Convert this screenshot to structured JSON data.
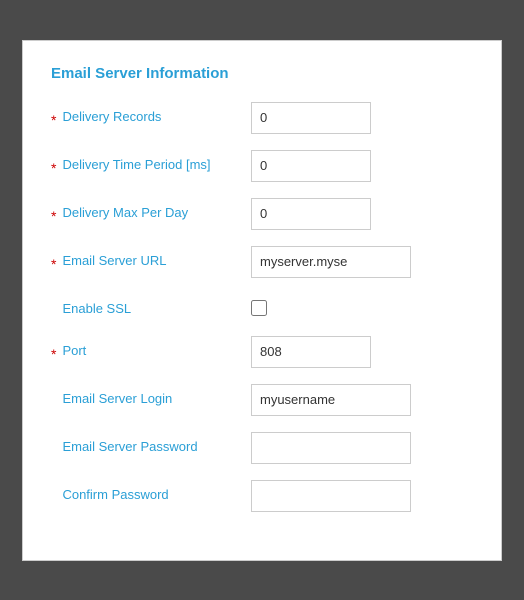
{
  "panel": {
    "title": "Email Server Information"
  },
  "fields": {
    "delivery_records": {
      "label": "Delivery Records",
      "value": "0",
      "required": true
    },
    "delivery_time_period": {
      "label": "Delivery Time Period [ms]",
      "value": "0",
      "required": true
    },
    "delivery_max_per_day": {
      "label": "Delivery Max Per Day",
      "value": "0",
      "required": true
    },
    "email_server_url": {
      "label": "Email Server URL",
      "value": "myserver.myse",
      "required": true
    },
    "enable_ssl": {
      "label": "Enable SSL",
      "required": false
    },
    "port": {
      "label": "Port",
      "value": "808",
      "required": true
    },
    "email_server_login": {
      "label": "Email Server Login",
      "value": "myusername",
      "required": false
    },
    "email_server_password": {
      "label": "Email Server Password",
      "value": "",
      "required": false
    },
    "confirm_password": {
      "label": "Confirm Password",
      "value": "",
      "required": false
    }
  }
}
